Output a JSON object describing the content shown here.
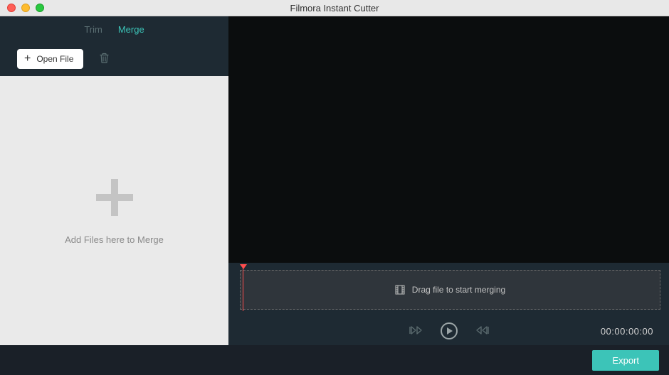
{
  "window": {
    "title": "Filmora Instant Cutter"
  },
  "tabs": {
    "trim": "Trim",
    "merge": "Merge"
  },
  "toolbar": {
    "open_file_label": "Open File"
  },
  "drop_area": {
    "text": "Add Files here to Merge"
  },
  "timeline": {
    "placeholder": "Drag file to start merging"
  },
  "controls": {
    "timecode": "00:00:00:00"
  },
  "footer": {
    "export_label": "Export"
  }
}
